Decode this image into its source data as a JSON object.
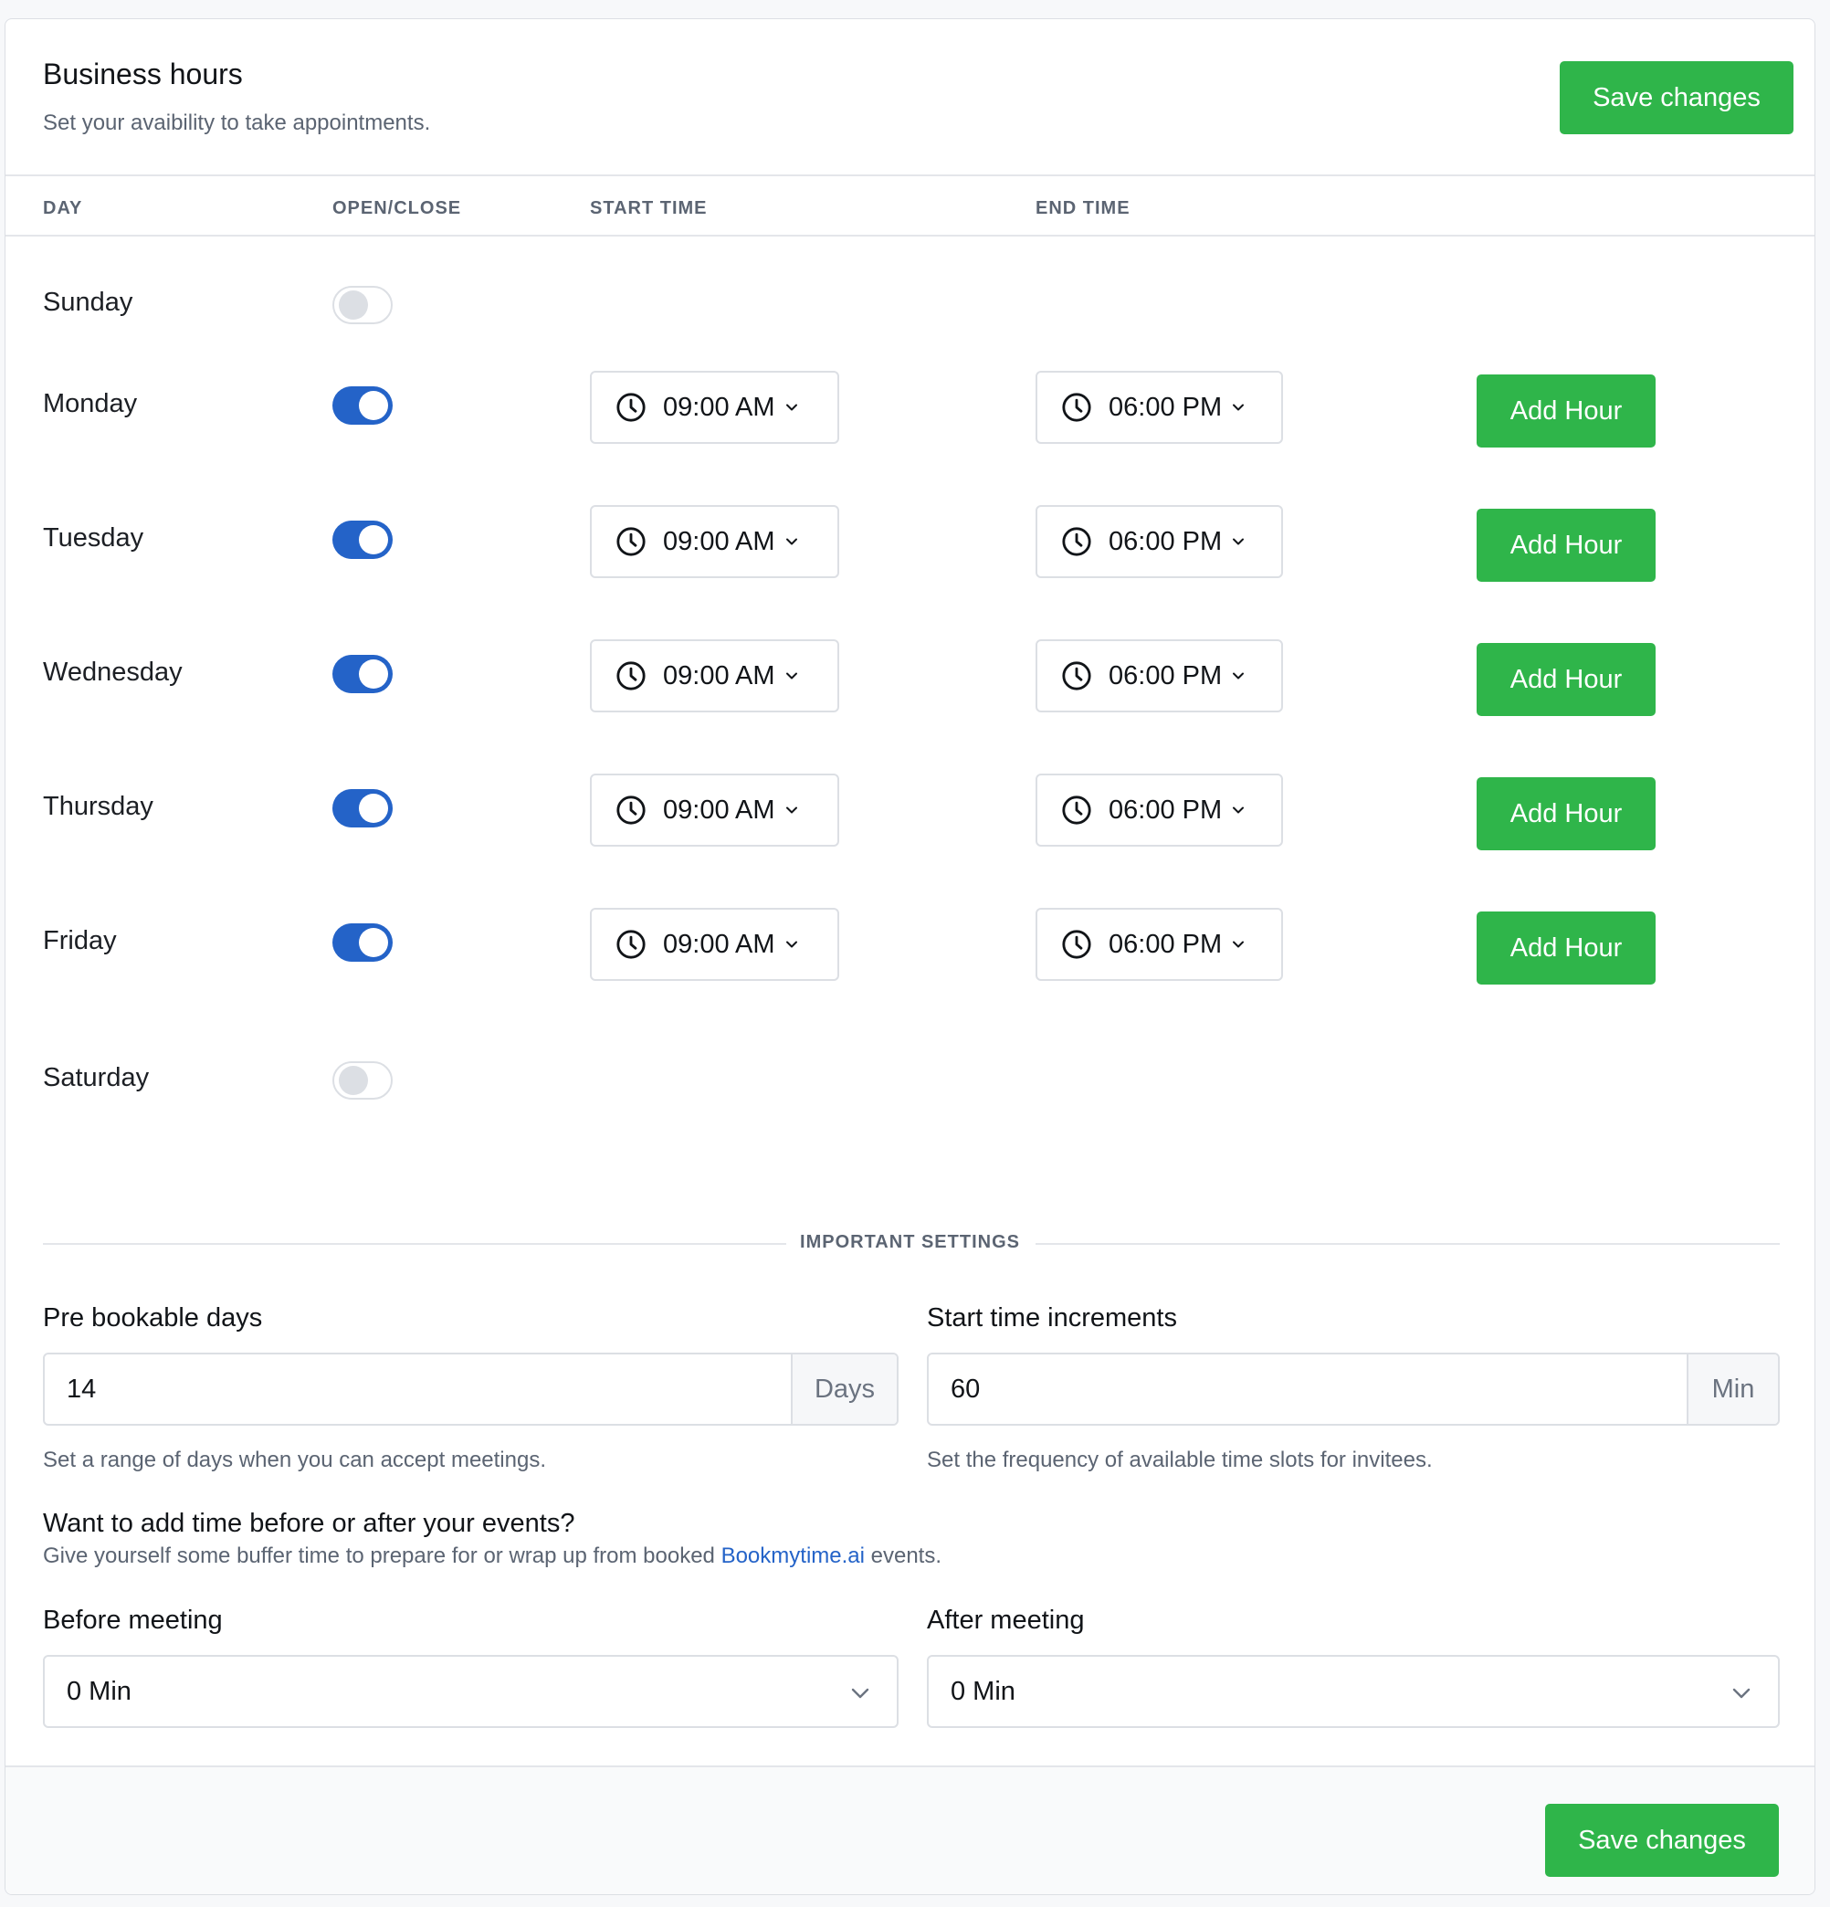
{
  "header": {
    "title": "Business hours",
    "subtitle": "Set your avaibility to take appointments.",
    "save_label": "Save changes"
  },
  "columns": {
    "day": "DAY",
    "open_close": "OPEN/CLOSE",
    "start_time": "START TIME",
    "end_time": "END TIME"
  },
  "days": [
    {
      "name": "Sunday",
      "open": false
    },
    {
      "name": "Monday",
      "open": true,
      "start": "09:00 AM",
      "end": "06:00 PM",
      "action": "Add Hour"
    },
    {
      "name": "Tuesday",
      "open": true,
      "start": "09:00 AM",
      "end": "06:00 PM",
      "action": "Add Hour"
    },
    {
      "name": "Wednesday",
      "open": true,
      "start": "09:00 AM",
      "end": "06:00 PM",
      "action": "Add Hour"
    },
    {
      "name": "Thursday",
      "open": true,
      "start": "09:00 AM",
      "end": "06:00 PM",
      "action": "Add Hour"
    },
    {
      "name": "Friday",
      "open": true,
      "start": "09:00 AM",
      "end": "06:00 PM",
      "action": "Add Hour"
    },
    {
      "name": "Saturday",
      "open": false
    }
  ],
  "settings": {
    "divider_label": "IMPORTANT SETTINGS",
    "pre_bookable": {
      "label": "Pre bookable days",
      "value": "14",
      "unit": "Days",
      "help": "Set a range of days when you can accept meetings."
    },
    "increments": {
      "label": "Start time increments",
      "value": "60",
      "unit": "Min",
      "help": "Set the frequency of available time slots for invitees."
    },
    "buffer": {
      "title": "Want to add time before or after your events?",
      "desc_before": "Give yourself some buffer time to prepare for or wrap up from booked ",
      "link": "Bookmytime.ai",
      "desc_after": " events."
    },
    "before_meeting": {
      "label": "Before meeting",
      "value": "0 Min"
    },
    "after_meeting": {
      "label": "After meeting",
      "value": "0 Min"
    }
  },
  "footer": {
    "save_label": "Save changes"
  },
  "icons": {
    "clock": "clock-icon",
    "chevron": "chevron-down-icon"
  },
  "colors": {
    "accent_green": "#2fb54a",
    "toggle_blue": "#2463c8",
    "link_blue": "#2463c8"
  }
}
